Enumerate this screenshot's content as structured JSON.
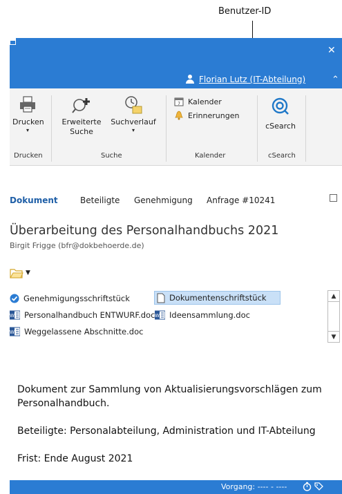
{
  "annotation": {
    "label": "Benutzer-ID"
  },
  "window": {
    "user_name": "Florian Lutz (IT-Abteilung)"
  },
  "ribbon": {
    "print_label": "Drucken",
    "print_group": "Drucken",
    "advanced_search_line1": "Erweiterte",
    "advanced_search_line2": "Suche",
    "search_history": "Suchverlauf",
    "search_group": "Suche",
    "calendar": "Kalender",
    "reminders": "Erinnerungen",
    "calendar_group": "Kalender",
    "csearch": "cSearch",
    "csearch_group": "cSearch"
  },
  "tabs": [
    {
      "label": "Dokument",
      "active": true
    },
    {
      "label": "Beteiligte"
    },
    {
      "label": "Genehmigung"
    },
    {
      "label": "Anfrage #10241"
    }
  ],
  "document": {
    "title": "Überarbeitung des Personalhandbuchs 2021",
    "author": "Birgit Frigge (bfr@dokbehoerde.de)"
  },
  "attachments": [
    {
      "label": "Genehmigungsschriftstück",
      "icon": "check-circle-icon"
    },
    {
      "label": "Dokumentenschriftstück",
      "icon": "document-icon",
      "selected": true
    },
    {
      "label": "Personalhandbuch ENTWURF.doc",
      "icon": "word-icon"
    },
    {
      "label": "Ideensammlung.doc",
      "icon": "word-icon"
    },
    {
      "label": "Weggelassene Abschnitte.doc",
      "icon": "word-icon"
    }
  ],
  "body": {
    "para1": "Dokument zur Sammlung von Aktualisierungsvorschlägen zum Personalhandbuch.",
    "para2": "Beteiligte: Personalabteilung, Administration und IT-Abteilung",
    "para3": "Frist: Ende August 2021"
  },
  "status": {
    "text": "Vorgang: ---- - ----"
  },
  "colors": {
    "accent": "#2b7cd3",
    "ribbon_bg": "#f3f3f3",
    "selected_bg": "#c9e0f7"
  }
}
